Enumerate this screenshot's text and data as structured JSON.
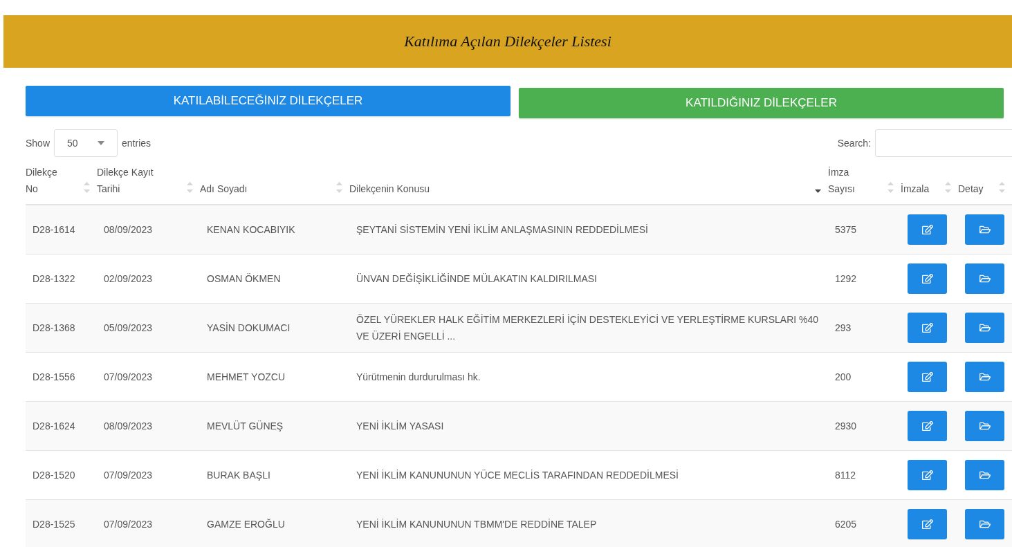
{
  "title": "Katılıma Açılan Dilekçeler Listesi",
  "tabs": [
    {
      "label": "KATILABİLECEĞİNİZ DİLEKÇELER",
      "color": "#1e88e5"
    },
    {
      "label": "KATILDIĞINIZ DİLEKÇELER",
      "color": "#4caf50"
    }
  ],
  "length": {
    "before": "Show",
    "value": "50",
    "after": "entries"
  },
  "search": {
    "label": "Search:"
  },
  "columns": [
    {
      "label": "Dilekçe No",
      "sorted": false
    },
    {
      "label": "Dilekçe Kayıt Tarihi",
      "sorted": false
    },
    {
      "label": "Adı Soyadı",
      "sorted": false
    },
    {
      "label": "Dilekçenin Konusu",
      "sorted": true
    },
    {
      "label": "İmza Sayısı",
      "sorted": false
    },
    {
      "label": "İmzala",
      "sorted": false
    },
    {
      "label": "Detay",
      "sorted": false
    }
  ],
  "rows": [
    {
      "no": "D28-1614",
      "date": "08/09/2023",
      "name": "KENAN KOCABIYIK",
      "subject": "ŞEYTANİ SİSTEMİN YENİ İKLİM ANLAŞMASININ REDDEDİLMESİ",
      "count": "5375"
    },
    {
      "no": "D28-1322",
      "date": "02/09/2023",
      "name": "OSMAN ÖKMEN",
      "subject": "ÜNVAN DEĞİŞİKLİĞİNDE MÜLAKATIN KALDIRILMASI",
      "count": "1292"
    },
    {
      "no": "D28-1368",
      "date": "05/09/2023",
      "name": "YASİN DOKUMACI",
      "subject": "ÖZEL YÜREKLER HALK EĞİTİM MERKEZLERİ İÇİN DESTEKLEYİCİ VE YERLEŞTİRME KURSLARI %40 VE ÜZERİ ENGELLİ ...",
      "count": "293"
    },
    {
      "no": "D28-1556",
      "date": "07/09/2023",
      "name": "MEHMET YOZCU",
      "subject": "Yürütmenin durdurulması hk.",
      "count": "200"
    },
    {
      "no": "D28-1624",
      "date": "08/09/2023",
      "name": "MEVLÜT GÜNEŞ",
      "subject": "YENİ İKLİM YASASI",
      "count": "2930"
    },
    {
      "no": "D28-1520",
      "date": "07/09/2023",
      "name": "BURAK BAŞLI",
      "subject": "YENİ İKLİM KANUNUNUN YÜCE MECLİS TARAFINDAN REDDEDİLMESİ",
      "count": "8112"
    },
    {
      "no": "D28-1525",
      "date": "07/09/2023",
      "name": "GAMZE EROĞLU",
      "subject": "YENİ İKLİM KANUNUNUN TBMM'DE REDDİNE TALEP",
      "count": "6205"
    }
  ]
}
